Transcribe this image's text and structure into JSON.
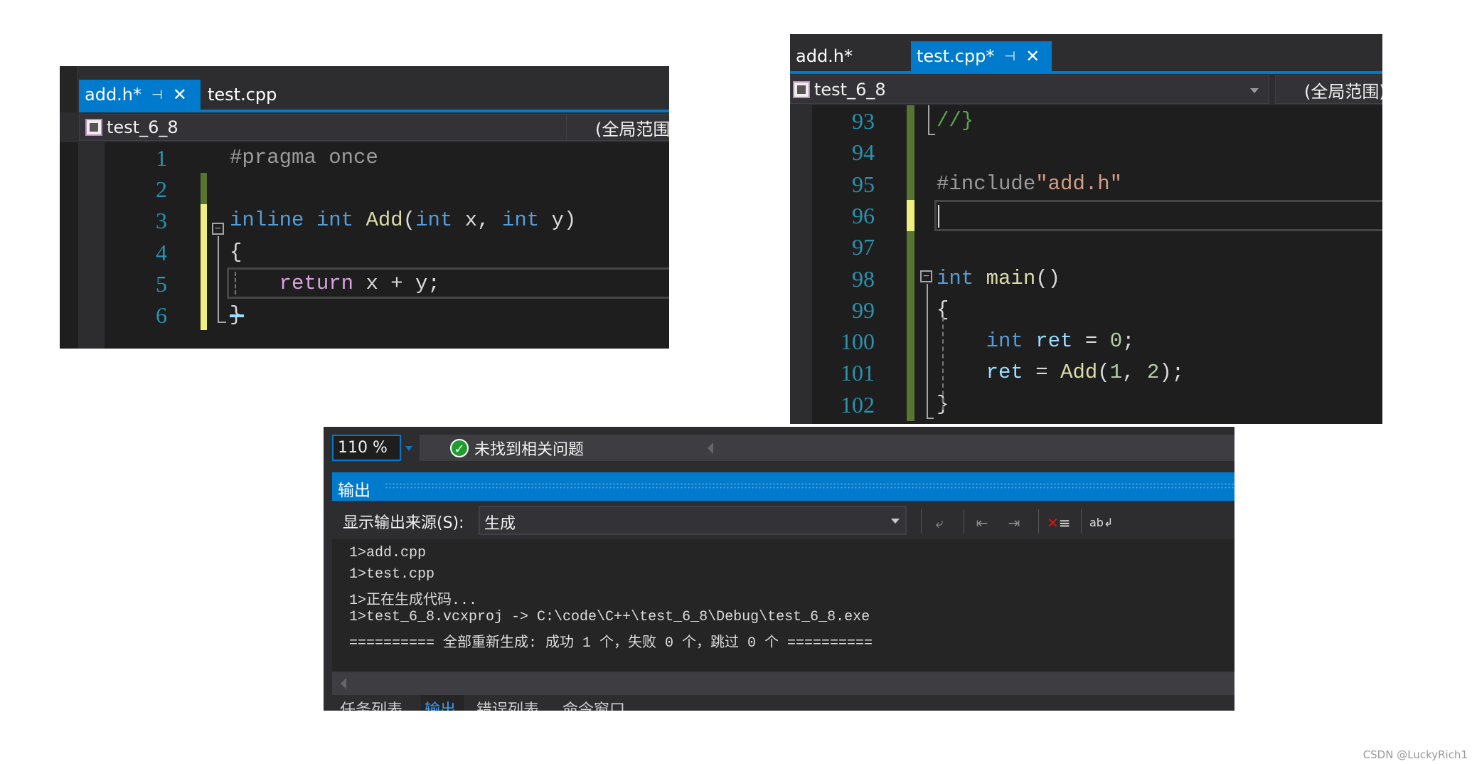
{
  "left_editor": {
    "tabs": [
      {
        "label": "add.h*",
        "active": true
      },
      {
        "label": "test.cpp",
        "active": false
      }
    ],
    "project": "test_6_8",
    "scope": "(全局范围",
    "line_numbers": [
      "1",
      "2",
      "3",
      "4",
      "5",
      "6"
    ],
    "code": [
      [
        {
          "t": "#pragma once",
          "c": "#9b9b9b"
        }
      ],
      [],
      [
        {
          "t": "inline",
          "c": "#569cd6"
        },
        {
          "t": " "
        },
        {
          "t": "int",
          "c": "#569cd6"
        },
        {
          "t": " "
        },
        {
          "t": "Add",
          "c": "#dcdcaa"
        },
        {
          "t": "("
        },
        {
          "t": "int",
          "c": "#569cd6"
        },
        {
          "t": " x, "
        },
        {
          "t": "int",
          "c": "#569cd6"
        },
        {
          "t": " y)"
        }
      ],
      [
        {
          "t": "{"
        }
      ],
      [
        {
          "t": "    "
        },
        {
          "t": "return",
          "c": "#d8a0df"
        },
        {
          "t": " x + y;"
        }
      ],
      [
        {
          "t": "}"
        }
      ]
    ]
  },
  "right_editor": {
    "tabs": [
      {
        "label": "add.h*",
        "active": false
      },
      {
        "label": "test.cpp*",
        "active": true
      }
    ],
    "project": "test_6_8",
    "scope": "(全局范围)",
    "line_numbers": [
      "93",
      "94",
      "95",
      "96",
      "97",
      "98",
      "99",
      "100",
      "101",
      "102"
    ],
    "code": [
      [
        {
          "t": "//}",
          "c": "#57a64a"
        }
      ],
      [],
      [
        {
          "t": "#include",
          "c": "#9b9b9b"
        },
        {
          "t": "\"add.h\"",
          "c": "#d69d85"
        }
      ],
      [],
      [],
      [
        {
          "t": "int",
          "c": "#569cd6"
        },
        {
          "t": " "
        },
        {
          "t": "main",
          "c": "#dcdcaa"
        },
        {
          "t": "()"
        }
      ],
      [
        {
          "t": "{"
        }
      ],
      [
        {
          "t": "    "
        },
        {
          "t": "int",
          "c": "#569cd6"
        },
        {
          "t": " "
        },
        {
          "t": "ret",
          "c": "#9cdcfe"
        },
        {
          "t": " = "
        },
        {
          "t": "0",
          "c": "#b5cea8"
        },
        {
          "t": ";"
        }
      ],
      [
        {
          "t": "    "
        },
        {
          "t": "ret",
          "c": "#9cdcfe"
        },
        {
          "t": " = "
        },
        {
          "t": "Add",
          "c": "#dcdcaa"
        },
        {
          "t": "("
        },
        {
          "t": "1",
          "c": "#b5cea8"
        },
        {
          "t": ", "
        },
        {
          "t": "2",
          "c": "#b5cea8"
        },
        {
          "t": ");"
        }
      ],
      [
        {
          "t": "}"
        }
      ]
    ]
  },
  "output_panel": {
    "zoom": "110 %",
    "status": "未找到相关问题",
    "title": "输出",
    "source_label": "显示输出来源(S):",
    "source_value": "生成",
    "lines": [
      "1>add.cpp",
      "1>test.cpp",
      "1>正在生成代码...",
      "1>test_6_8.vcxproj -> C:\\code\\C++\\test_6_8\\Debug\\test_6_8.exe",
      "========== 全部重新生成: 成功 1 个，失败 0 个，跳过 0 个 =========="
    ],
    "bottom_tabs": [
      {
        "label": "任务列表"
      },
      {
        "label": "输出",
        "active": true
      },
      {
        "label": "错误列表"
      },
      {
        "label": "命令窗口"
      }
    ],
    "toolbar_icons": [
      "go-to-location-icon",
      "previous-message-icon",
      "next-message-icon",
      "clear-all-icon",
      "word-wrap-icon"
    ]
  },
  "watermark": "CSDN @LuckyRich1",
  "colors": {
    "accent": "#007acc",
    "line_number": "#2b91af",
    "saved_change": "#577430",
    "unsaved_change": "#efef7f"
  }
}
